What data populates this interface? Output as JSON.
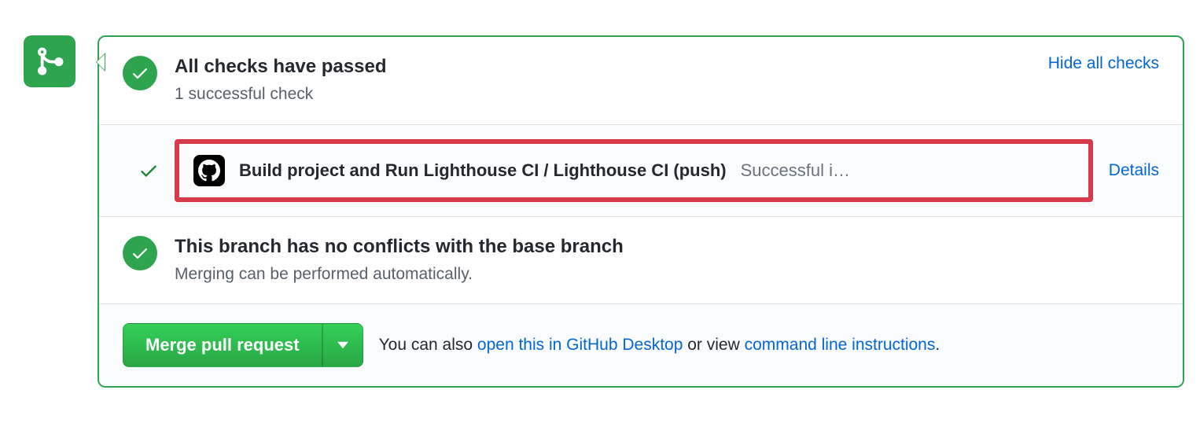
{
  "checksSection": {
    "title": "All checks have passed",
    "subtitle": "1 successful check",
    "toggleLabel": "Hide all checks"
  },
  "checks": [
    {
      "name": "Build project and Run Lighthouse CI / Lighthouse CI (push)",
      "status": "Successful i…",
      "detailsLabel": "Details"
    }
  ],
  "conflictsSection": {
    "title": "This branch has no conflicts with the base branch",
    "subtitle": "Merging can be performed automatically."
  },
  "mergeAction": {
    "buttonLabel": "Merge pull request",
    "helpPrefix": "You can also ",
    "desktopLink": "open this in GitHub Desktop",
    "helpMiddle": " or view ",
    "cliLink": "command line instructions",
    "helpSuffix": "."
  }
}
